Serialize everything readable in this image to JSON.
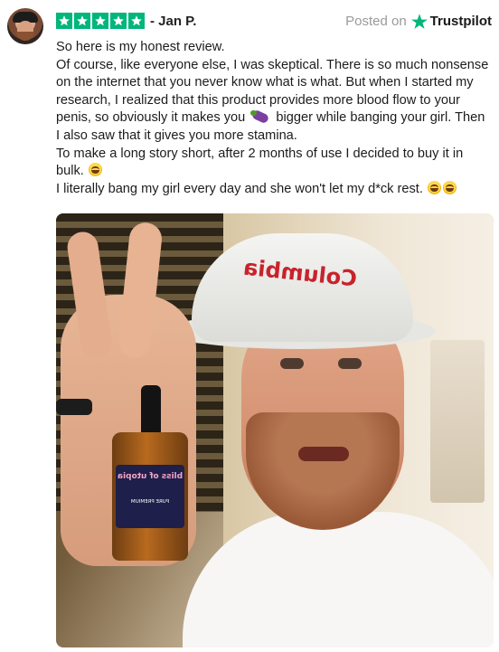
{
  "reviewer": {
    "name": "- Jan P.",
    "rating": 5
  },
  "source": {
    "prefix": "Posted on",
    "brand": "Trustpilot",
    "brand_color": "#00b67a"
  },
  "review": {
    "lines": [
      "So here is my honest review.",
      "Of course, like everyone else, I was skeptical. There is so much nonsense on the internet that you never know what is what. But when I started my research, I realized that this product provides more blood flow to your penis, so obviously it makes you",
      "bigger while banging your girl. Then I also saw that it gives you more stamina.",
      "To make a long story short, after 2 months of use I decided to buy it in bulk.",
      "I literally bang my girl every day and she won't let my d*ck rest."
    ]
  },
  "photo": {
    "hat_text": "Columbia",
    "bottle_label_title": "bliss of utopia",
    "bottle_label_sub": "PURE PREMIUM"
  },
  "icons": {
    "star": "star-icon",
    "emoji_laugh": "laughing-emoji",
    "emoji_eggplant": "eggplant-emoji"
  }
}
